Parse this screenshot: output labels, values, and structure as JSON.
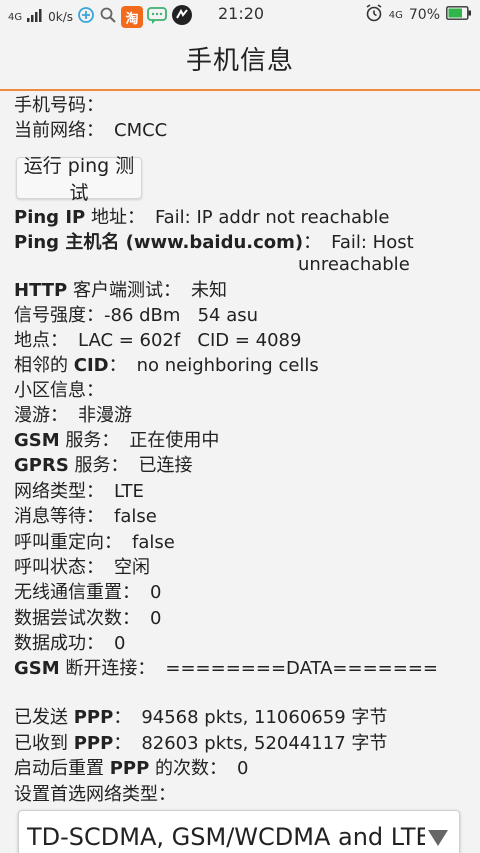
{
  "status": {
    "net_type": "4G",
    "speed": "0k/s",
    "time": "21:20",
    "battery_net": "4G",
    "battery": "70%",
    "taobao_icon": "淘"
  },
  "header": {
    "title": "手机信息"
  },
  "info": {
    "phone_number_label": "手机号码：",
    "phone_number_value": "",
    "network_label": "当前网络：",
    "network_value": "CMCC",
    "ping_button": "运行 ping 测试",
    "ping_ip_label_b": "Ping IP",
    "ping_ip_label": " 地址：",
    "ping_ip_value": "Fail: IP addr not reachable",
    "ping_host_label_b": "Ping 主机名 (www.baidu.com)",
    "ping_host_label": "：",
    "ping_host_value_1": "Fail: Host",
    "ping_host_value_2": "unreachable",
    "http_label_b": "HTTP",
    "http_label": " 客户端测试：",
    "http_value": "未知",
    "signal_label": "信号强度：",
    "signal_value": "-86 dBm   54 asu",
    "location_label": "地点：",
    "location_value": "LAC = 602f   CID = 4089",
    "neighbor_label": "相邻的 ",
    "neighbor_label_b": "CID",
    "neighbor_label_2": "：",
    "neighbor_value": "no neighboring cells",
    "cell_info_label": "小区信息：",
    "roaming_label": "漫游：",
    "roaming_value": "非漫游",
    "gsm_service_label_b": "GSM",
    "gsm_service_label": " 服务：",
    "gsm_service_value": "正在使用中",
    "gprs_label_b": "GPRS",
    "gprs_label": " 服务：",
    "gprs_value": "已连接",
    "net_type_label": "网络类型：",
    "net_type_value": "LTE",
    "msg_wait_label": "消息等待：",
    "msg_wait_value": "false",
    "call_redirect_label": "呼叫重定向：",
    "call_redirect_value": "false",
    "call_state_label": "呼叫状态：",
    "call_state_value": "空闲",
    "radio_reset_label": "无线通信重置：",
    "radio_reset_value": "0",
    "data_attempts_label": "数据尝试次数：",
    "data_attempts_value": "0",
    "data_success_label": "数据成功：",
    "data_success_value": "0",
    "gsm_disconnect_label_b": "GSM",
    "gsm_disconnect_label": " 断开连接：",
    "gsm_disconnect_value": "========DATA=======",
    "ppp_sent_label": "已发送 ",
    "ppp_sent_label_b": "PPP",
    "ppp_sent_label_2": "：",
    "ppp_sent_value": "94568 pkts, 11060659 字节",
    "ppp_recv_label": "已收到 ",
    "ppp_recv_label_b": "PPP",
    "ppp_recv_label_2": "：",
    "ppp_recv_value": "82603 pkts, 52044117 字节",
    "ppp_reset_label": "启动后重置 ",
    "ppp_reset_label_b": "PPP",
    "ppp_reset_label_2": " 的次数：",
    "ppp_reset_value": "0",
    "pref_net_label": "设置首选网络类型：",
    "pref_net_value": "TD-SCDMA, GSM/WCDMA and LTE"
  }
}
